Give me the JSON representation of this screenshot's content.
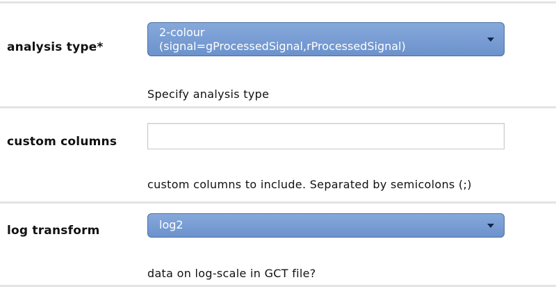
{
  "fields": {
    "analysis_type": {
      "label": "analysis type*",
      "selected_line1": "2-colour",
      "selected_line2": "(signal=gProcessedSignal,rProcessedSignal)",
      "help": "Specify analysis type"
    },
    "custom_columns": {
      "label": "custom columns",
      "value": "",
      "help": "custom columns to include. Separated by semicolons (;)"
    },
    "log_transform": {
      "label": "log transform",
      "selected": "log2",
      "help": "data on log-scale in GCT file?"
    }
  },
  "icons": {
    "dropdown": "chevron-down-icon"
  },
  "colors": {
    "select_bg": "#7a9fd6",
    "select_text": "#ffffff",
    "divider": "#e3e3e3"
  }
}
